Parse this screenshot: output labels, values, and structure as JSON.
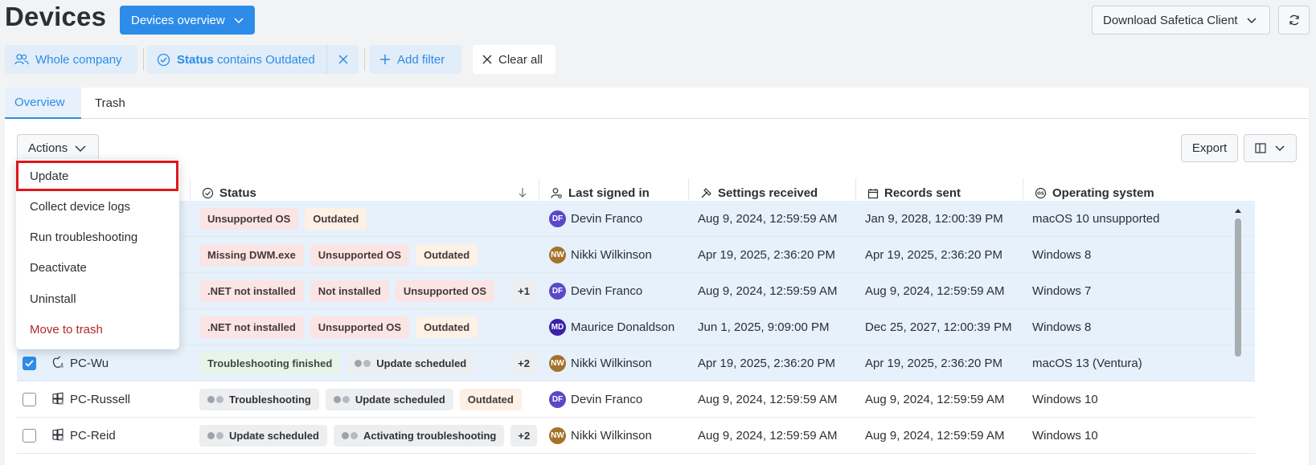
{
  "header": {
    "title": "Devices",
    "view_select": "Devices overview",
    "download_label": "Download Safetica Client"
  },
  "filters": {
    "company": "Whole company",
    "status_field": "Status",
    "status_op": "contains",
    "status_value": "Outdated",
    "add_filter": "Add filter",
    "clear_all": "Clear all"
  },
  "tabs": [
    {
      "label": "Overview",
      "active": true
    },
    {
      "label": "Trash",
      "active": false
    }
  ],
  "toolbar": {
    "actions_label": "Actions",
    "export_label": "Export"
  },
  "columns": {
    "status": "Status",
    "last_signed_in": "Last signed in",
    "settings_received": "Settings received",
    "records_sent": "Records sent",
    "operating_system": "Operating system"
  },
  "menu": {
    "items": [
      {
        "label": "Update",
        "highlighted": true
      },
      {
        "label": "Collect device logs"
      },
      {
        "label": "Run troubleshooting"
      },
      {
        "label": "Deactivate"
      },
      {
        "label": "Uninstall"
      },
      {
        "label": "Move to trash",
        "danger": true
      }
    ]
  },
  "rows": [
    {
      "name": "",
      "checked": false,
      "selected": true,
      "tags": [
        {
          "label": "Unsupported OS",
          "kind": "red"
        },
        {
          "label": "Outdated",
          "kind": "orange"
        }
      ],
      "user_initials": "DF",
      "user": "Devin Franco",
      "settings": "Aug 9, 2024, 12:59:59 AM",
      "records": "Jan 9, 2028, 12:00:39 PM",
      "os": "macOS 10 unsupported"
    },
    {
      "name": "",
      "checked": false,
      "selected": true,
      "tags": [
        {
          "label": "Missing DWM.exe",
          "kind": "red"
        },
        {
          "label": "Unsupported OS",
          "kind": "red"
        },
        {
          "label": "Outdated",
          "kind": "orange"
        }
      ],
      "user_initials": "NW",
      "user": "Nikki Wilkinson",
      "settings": "Apr 19, 2025, 2:36:20 PM",
      "records": "Apr 19, 2025, 2:36:20 PM",
      "os": "Windows 8"
    },
    {
      "name": "",
      "checked": false,
      "selected": true,
      "tags": [
        {
          "label": ".NET not installed",
          "kind": "red"
        },
        {
          "label": "Not installed",
          "kind": "red"
        },
        {
          "label": "Unsupported OS",
          "kind": "red"
        },
        {
          "label": "+1",
          "kind": "more"
        }
      ],
      "user_initials": "DF",
      "user": "Devin Franco",
      "settings": "Aug 9, 2024, 12:59:59 AM",
      "records": "Aug 9, 2024, 12:59:59 AM",
      "os": "Windows 7"
    },
    {
      "name": "",
      "checked": false,
      "selected": true,
      "tags": [
        {
          "label": ".NET not installed",
          "kind": "red"
        },
        {
          "label": "Unsupported OS",
          "kind": "red"
        },
        {
          "label": "Outdated",
          "kind": "orange"
        }
      ],
      "user_initials": "MD",
      "user": "Maurice Donaldson",
      "settings": "Jun 1, 2025, 9:09:00 PM",
      "records": "Dec 25, 2027, 12:00:39 PM",
      "os": "Windows 8"
    },
    {
      "name": "PC-Wu",
      "platform": "apple",
      "checked": true,
      "selected": true,
      "tags": [
        {
          "label": "Troubleshooting finished",
          "kind": "green"
        },
        {
          "label": "Update scheduled",
          "kind": "gray",
          "dots": true
        },
        {
          "label": "+2",
          "kind": "more"
        }
      ],
      "user_initials": "NW",
      "user": "Nikki Wilkinson",
      "settings": "Apr 19, 2025, 2:36:20 PM",
      "records": "Apr 19, 2025, 2:36:20 PM",
      "os": "macOS 13 (Ventura)"
    },
    {
      "name": "PC-Russell",
      "platform": "windows",
      "checked": false,
      "selected": false,
      "tags": [
        {
          "label": "Troubleshooting",
          "kind": "gray",
          "dots": true
        },
        {
          "label": "Update scheduled",
          "kind": "gray",
          "dots": true
        },
        {
          "label": "Outdated",
          "kind": "orange"
        }
      ],
      "user_initials": "DF",
      "user": "Devin Franco",
      "settings": "Aug 9, 2024, 12:59:59 AM",
      "records": "Aug 9, 2024, 12:59:59 AM",
      "os": "Windows 10"
    },
    {
      "name": "PC-Reid",
      "platform": "windows",
      "checked": false,
      "selected": false,
      "tags": [
        {
          "label": "Update scheduled",
          "kind": "gray",
          "dots": true
        },
        {
          "label": "Activating troubleshooting",
          "kind": "gray",
          "dots": true
        },
        {
          "label": "+2",
          "kind": "more"
        }
      ],
      "user_initials": "NW",
      "user": "Nikki Wilkinson",
      "settings": "Aug 9, 2024, 12:59:59 AM",
      "records": "Aug 9, 2024, 12:59:59 AM",
      "os": "Windows 10"
    }
  ]
}
